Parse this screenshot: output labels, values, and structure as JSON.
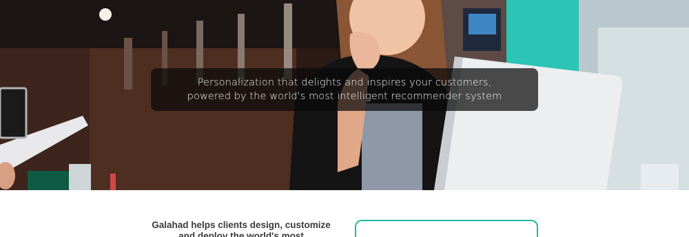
{
  "hero": {
    "image_icon": "hero-photo",
    "headline_line1": "Personalization that delights and inspires your customers,",
    "headline_line2": "powered by the world's most intelligent recommender system"
  },
  "intro": {
    "line1": "Galahad helps clients design, customize",
    "line2": "and deploy the world's most"
  },
  "colors": {
    "banner_bg": "#0a0a0a",
    "accent": "#1fb5a5",
    "body_text": "#3b3b3b"
  }
}
